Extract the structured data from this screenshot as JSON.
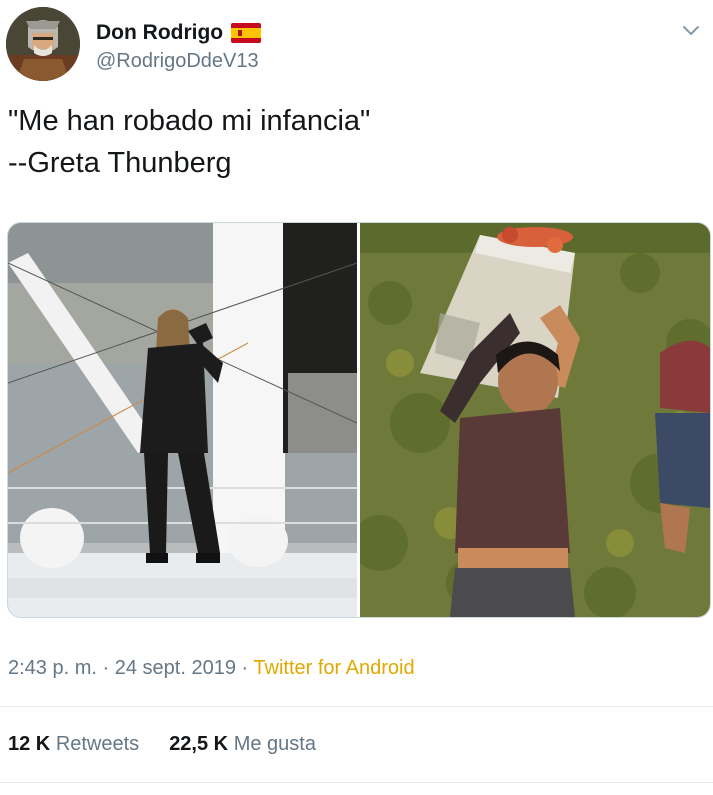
{
  "user": {
    "display_name": "Don Rodrigo",
    "handle": "@RodrigoDdeV13",
    "flag_icon": "spain-flag-icon",
    "avatar_icon": "knight-avatar",
    "menu_icon": "chevron-down-icon"
  },
  "tweet": {
    "text": "\"Me han robado mi infancia\"\n--Greta Thunberg"
  },
  "media": {
    "photo_count": 2
  },
  "meta": {
    "time": "2:43 p. m.",
    "separator": "·",
    "date": "24 sept. 2019",
    "source": "Twitter for Android"
  },
  "stats": {
    "retweets_count": "12 K",
    "retweets_label": "Retweets",
    "likes_count": "22,5 K",
    "likes_label": "Me gusta"
  },
  "colors": {
    "text": "#14171a",
    "secondary": "#657786",
    "source_link": "#e0a800",
    "divider": "#e6ecf0"
  }
}
